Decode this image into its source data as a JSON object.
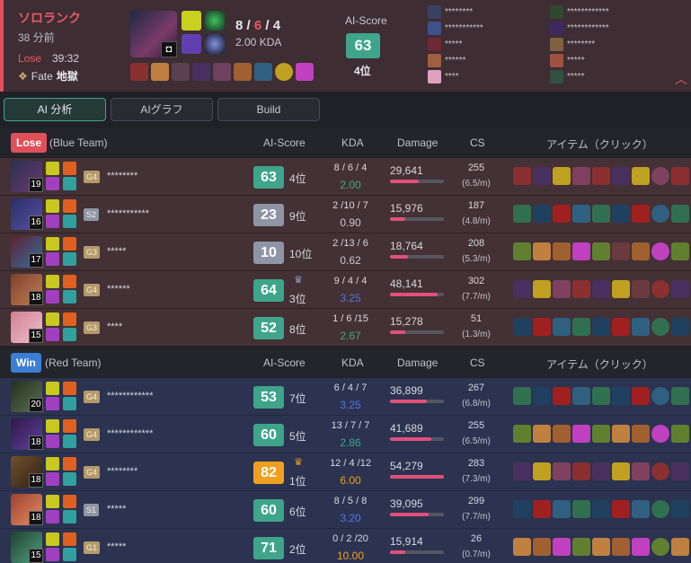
{
  "summary": {
    "queue": "ソロランク",
    "time_ago": "38 分前",
    "result": "Lose",
    "duration": "39:32",
    "fate_label": "Fate",
    "fate_value": "地獄",
    "champ_level": "",
    "kda": {
      "k": "8",
      "d": "6",
      "a": "4"
    },
    "kda_ratio": "2.00 KDA",
    "ai_score_label": "AI-Score",
    "ai_score": "63",
    "ai_rank": "4位",
    "players_left": [
      "********",
      "***********",
      "*****",
      "******",
      "****"
    ],
    "players_right": [
      "************",
      "************",
      "********",
      "*****",
      "*****"
    ]
  },
  "tabs": [
    {
      "label": "AI 分析",
      "active": true
    },
    {
      "label": "AIグラフ",
      "active": false
    },
    {
      "label": "Build",
      "active": false
    }
  ],
  "headers": {
    "ai_score": "AI-Score",
    "kda": "KDA",
    "damage": "Damage",
    "cs": "CS",
    "items": "アイテム（クリック）"
  },
  "blue_team": {
    "result": "Lose",
    "name": "(Blue Team)",
    "players": [
      {
        "level": "19",
        "rank": "G4",
        "name": "********",
        "score": "63",
        "score_color": "#3ea58a",
        "place": "4位",
        "crown": false,
        "kda": "8 / 6 / 4",
        "ratio": "2.00",
        "ratio_color": "#3ea58a",
        "damage": "29,641",
        "dmg_frac": 0.54,
        "cs": "255",
        "csm": "(6.5/m)"
      },
      {
        "level": "16",
        "rank": "S2",
        "name": "***********",
        "score": "23",
        "score_color": "#8e96a6",
        "place": "9位",
        "crown": false,
        "kda": "2 /10 / 7",
        "ratio": "0.90",
        "ratio_color": "#c8c8d0",
        "damage": "15,976",
        "dmg_frac": 0.29,
        "cs": "187",
        "csm": "(4.8/m)"
      },
      {
        "level": "17",
        "rank": "G3",
        "name": "*****",
        "score": "10",
        "score_color": "#8e96a6",
        "place": "10位",
        "crown": false,
        "kda": "2 /13 / 6",
        "ratio": "0.62",
        "ratio_color": "#c8c8d0",
        "damage": "18,764",
        "dmg_frac": 0.34,
        "cs": "208",
        "csm": "(5.3/m)"
      },
      {
        "level": "18",
        "rank": "G4",
        "name": "******",
        "score": "64",
        "score_color": "#3ea58a",
        "place": "3位",
        "crown": true,
        "crown_color": "#8ea0d0",
        "kda": "9 / 4 / 4",
        "ratio": "3.25",
        "ratio_color": "#5078e0",
        "damage": "48,141",
        "dmg_frac": 0.88,
        "cs": "302",
        "csm": "(7.7/m)"
      },
      {
        "level": "15",
        "rank": "G3",
        "name": "****",
        "score": "52",
        "score_color": "#3ea58a",
        "place": "8位",
        "crown": false,
        "kda": "1 / 6 /15",
        "ratio": "2.67",
        "ratio_color": "#3ea58a",
        "damage": "15,278",
        "dmg_frac": 0.28,
        "cs": "51",
        "csm": "(1.3/m)"
      }
    ]
  },
  "red_team": {
    "result": "Win",
    "name": "(Red Team)",
    "players": [
      {
        "level": "20",
        "rank": "G4",
        "name": "************",
        "score": "53",
        "score_color": "#3ea58a",
        "place": "7位",
        "crown": false,
        "kda": "6 / 4 / 7",
        "ratio": "3.25",
        "ratio_color": "#5078e0",
        "damage": "36,899",
        "dmg_frac": 0.68,
        "cs": "267",
        "csm": "(6.8/m)"
      },
      {
        "level": "18",
        "rank": "G4",
        "name": "************",
        "score": "60",
        "score_color": "#3ea58a",
        "place": "5位",
        "crown": false,
        "kda": "13 / 7 / 7",
        "ratio": "2.86",
        "ratio_color": "#3ea58a",
        "damage": "41,689",
        "dmg_frac": 0.77,
        "cs": "255",
        "csm": "(6.5/m)"
      },
      {
        "level": "18",
        "rank": "G4",
        "name": "********",
        "score": "82",
        "score_color": "#f0a020",
        "place": "1位",
        "crown": true,
        "crown_color": "#f0a020",
        "kda": "12 / 4 /12",
        "ratio": "6.00",
        "ratio_color": "#f0a020",
        "damage": "54,279",
        "dmg_frac": 1.0,
        "cs": "283",
        "csm": "(7.3/m)"
      },
      {
        "level": "18",
        "rank": "S1",
        "name": "*****",
        "score": "60",
        "score_color": "#3ea58a",
        "place": "6位",
        "crown": false,
        "kda": "8 / 5 / 8",
        "ratio": "3.20",
        "ratio_color": "#5078e0",
        "damage": "39,095",
        "dmg_frac": 0.72,
        "cs": "299",
        "csm": "(7.7/m)"
      },
      {
        "level": "15",
        "rank": "G1",
        "name": "*****",
        "score": "71",
        "score_color": "#3ea58a",
        "place": "2位",
        "crown": false,
        "kda": "0 / 2 /20",
        "ratio": "10.00",
        "ratio_color": "#f0a020",
        "damage": "15,914",
        "dmg_frac": 0.29,
        "cs": "26",
        "csm": "(0.7/m)"
      }
    ]
  },
  "colors": {
    "lose": "#e0505a",
    "win": "#3b7fd4",
    "good": "#3ea58a",
    "gold": "#f0a020"
  }
}
